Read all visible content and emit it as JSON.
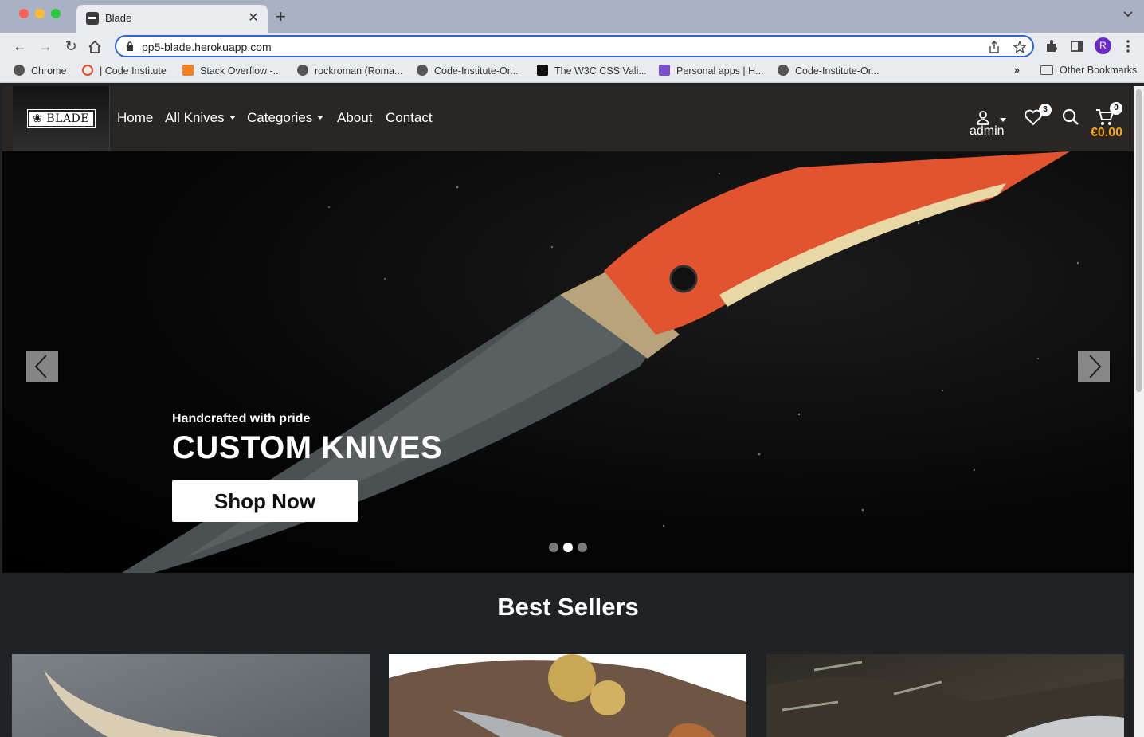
{
  "browser": {
    "tab_title": "Blade",
    "url": "pp5-blade.herokuapp.com",
    "profile_initial": "R",
    "bookmarks": [
      {
        "label": "Chrome"
      },
      {
        "label": "| Code Institute"
      },
      {
        "label": "Stack Overflow -..."
      },
      {
        "label": "rockroman (Roma..."
      },
      {
        "label": "Code-Institute-Or..."
      },
      {
        "label": "The W3C CSS Vali..."
      },
      {
        "label": "Personal apps | H..."
      },
      {
        "label": "Code-Institute-Or..."
      }
    ],
    "more_bookmarks": "»",
    "other_bookmarks": "Other Bookmarks"
  },
  "nav": {
    "logo_text": "BLADE",
    "links": {
      "home": "Home",
      "all_knives": "All Knives",
      "categories": "Categories",
      "about": "About",
      "contact": "Contact"
    },
    "account_label": "admin",
    "wishlist_count": "3",
    "cart_count": "0",
    "cart_total": "€0.00",
    "accent_color": "#f3a712"
  },
  "hero": {
    "subtitle": "Handcrafted with pride",
    "title": "CUSTOM KNIVES",
    "cta": "Shop Now",
    "slide_count": 3,
    "active_slide": 2
  },
  "best_sellers": {
    "title": "Best Sellers"
  }
}
